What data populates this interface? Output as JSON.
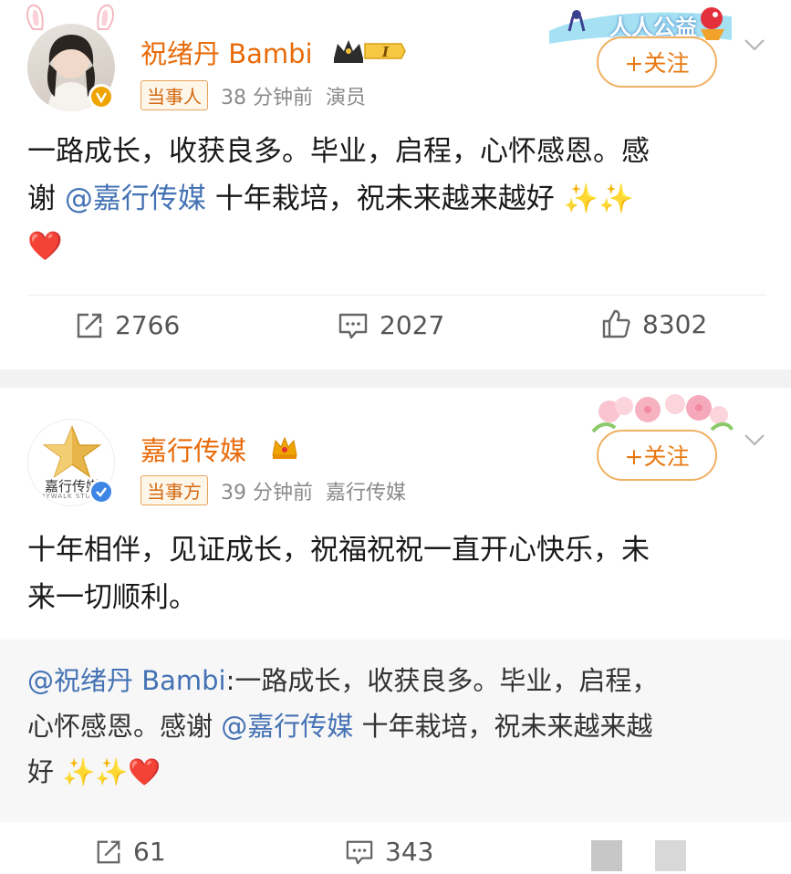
{
  "post1": {
    "user_name": "祝绪丹 Bambi",
    "tag": "当事人",
    "time": "38 分钟前",
    "source": "演员",
    "follow_label": "+关注",
    "banner_text": "人人公益",
    "text_line1": "一路成长，收获良多。毕业，启程，心怀感恩。感",
    "text_line2_a": "谢 ",
    "mention": "@嘉行传媒",
    "text_line2_b": " 十年栽培，祝未来越来越好 ✨✨",
    "heart": "❤️",
    "reposts": "2766",
    "comments": "2027",
    "likes": "8302"
  },
  "post2": {
    "user_name": "嘉行传媒",
    "avatar_text": "嘉行传媒",
    "avatar_subtext": "JAYWALK STUDIO",
    "tag": "当事方",
    "time": "39 分钟前",
    "source": "嘉行传媒",
    "follow_label": "+关注",
    "text_line1": "十年相伴，见证成长，祝福祝祝一直开心快乐，未",
    "text_line2": "来一切顺利。",
    "retweet": {
      "author": "@祝绪丹 Bambi",
      "line1_rest": ":一路成长，收获良多。毕业，启程，",
      "line2_a": "心怀感恩。感谢 ",
      "mention": "@嘉行传媒",
      "line2_b": " 十年栽培，祝未来越来越",
      "line3": "好 ✨✨❤️"
    },
    "reposts": "61",
    "comments": "343"
  },
  "colors": {
    "name": "#e86b0a",
    "mention": "#4472b4",
    "vip_badge": "#f0a400"
  }
}
